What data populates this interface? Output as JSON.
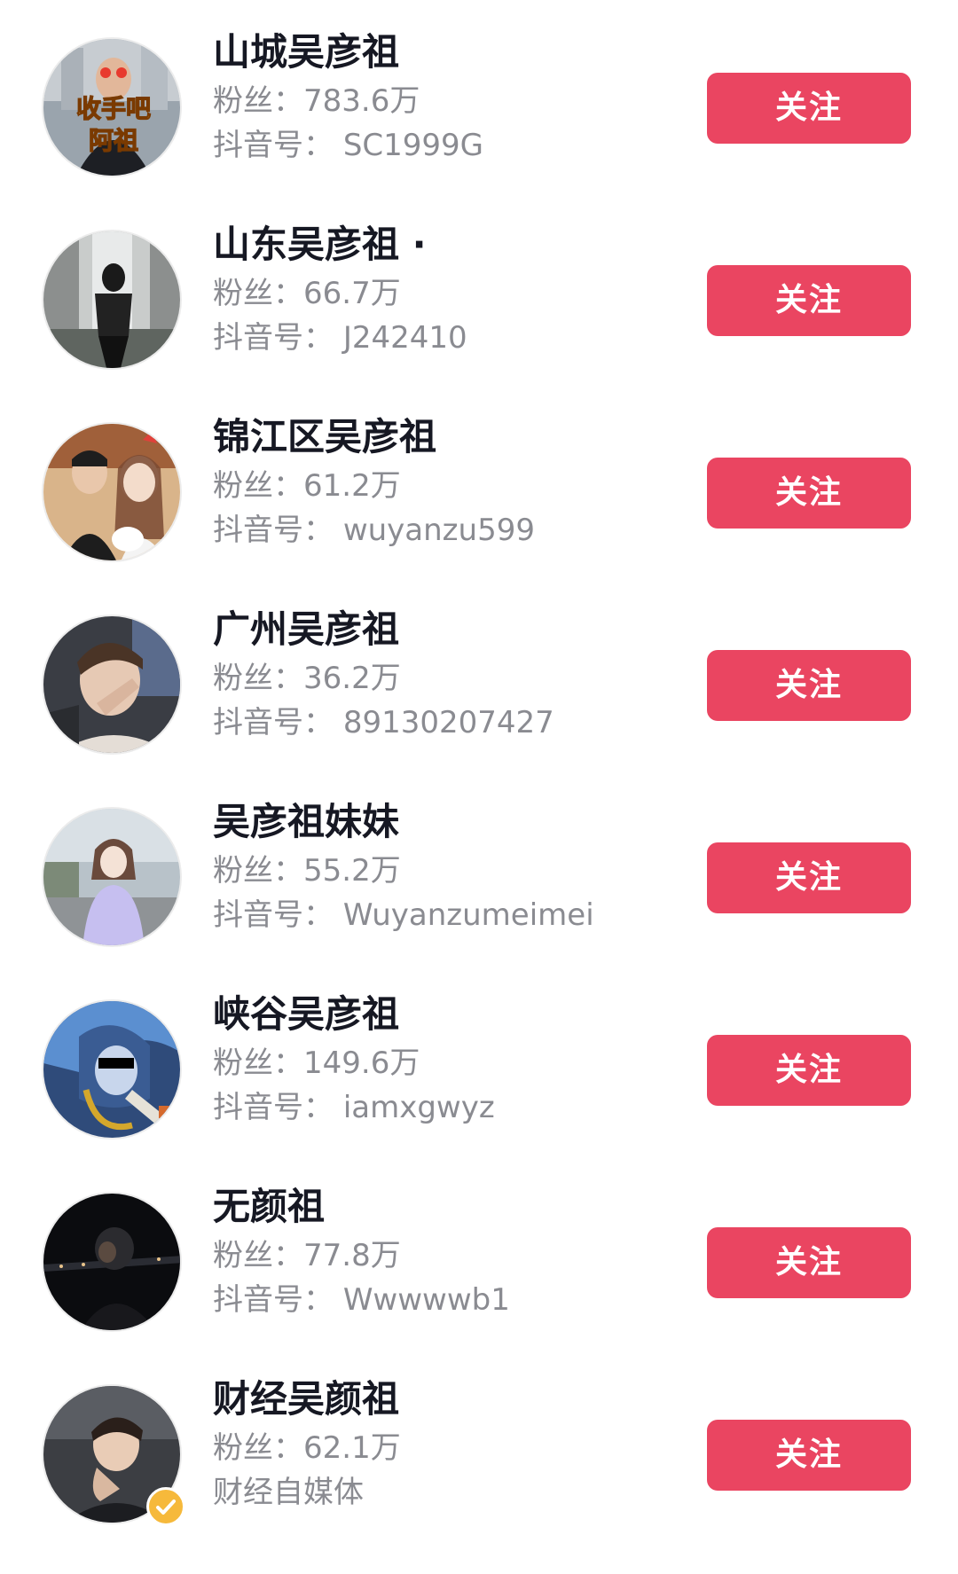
{
  "fans_label": "粉丝：",
  "id_label": "抖音号：",
  "follow_label": "关注",
  "colors": {
    "follow_button": "#ea4561",
    "name_text": "#161823",
    "meta_text": "#8a8b91",
    "verified_badge": "#f6b93b"
  },
  "users": [
    {
      "name": "山城吴彦祖",
      "fans": "783.6万",
      "id": "SC1999G",
      "avatar_text": "收手吧 阿祖"
    },
    {
      "name": "山东吴彦祖 ·",
      "fans": "66.7万",
      "id": "J242410"
    },
    {
      "name": "锦江区吴彦祖",
      "fans": "61.2万",
      "id": "wuyanzu599"
    },
    {
      "name": "广州吴彦祖",
      "fans": "36.2万",
      "id": "89130207427"
    },
    {
      "name": "吴彦祖妹妹",
      "fans": "55.2万",
      "id": "Wuyanzumeimei"
    },
    {
      "name": "峡谷吴彦祖",
      "fans": "149.6万",
      "id": "iamxgwyz"
    },
    {
      "name": "无颜祖",
      "fans": "77.8万",
      "id": "Wwwwwb1"
    },
    {
      "name": "财经吴颜祖",
      "fans": "62.1万",
      "subtitle": "财经自媒体",
      "verified": true,
      "verified_icon": "check-badge-icon"
    }
  ]
}
